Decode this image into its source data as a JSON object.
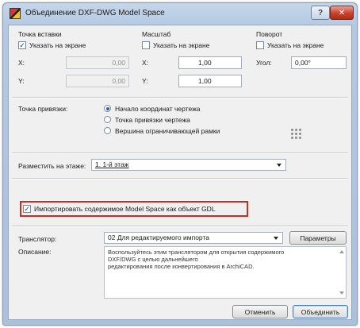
{
  "window": {
    "title": "Объединение DXF-DWG Model Space",
    "help_symbol": "?",
    "close_symbol": "✕"
  },
  "insertion": {
    "heading": "Точка вставки",
    "pick_on_screen": "Указать на экране",
    "pick_checked": true,
    "x_label": "X:",
    "x_value": "0,00",
    "y_label": "Y:",
    "y_value": "0,00"
  },
  "scale": {
    "heading": "Масштаб",
    "pick_on_screen": "Указать на экране",
    "pick_checked": false,
    "x_label": "X:",
    "x_value": "1,00",
    "y_label": "Y:",
    "y_value": "1,00"
  },
  "rotation": {
    "heading": "Поворот",
    "pick_on_screen": "Указать на экране",
    "pick_checked": false,
    "angle_label": "Угол:",
    "angle_value": "0,00°"
  },
  "anchor": {
    "label": "Точка привязки:",
    "options": [
      "Начало координат чертежа",
      "Точка привязки чертежа",
      "Вершина ограничивающей рамки"
    ],
    "selected_index": 0
  },
  "floor": {
    "label": "Разместить на этаже:",
    "value": "1. 1-й этаж"
  },
  "gdl_import": {
    "label": "Импортировать содержимое Model Space как объект GDL",
    "checked": true
  },
  "translator": {
    "label": "Транслятор:",
    "value": "02 Для редактируемого импорта",
    "params_button": "Параметры"
  },
  "description": {
    "label": "Описание:",
    "lines": [
      "Воспользуйтесь этим транслятором для открытия содержимого",
      "DXF/DWG с целью дальнейшего",
      "редактирования после конвертирования в ArchiCAD."
    ]
  },
  "footer": {
    "cancel": "Отменить",
    "merge": "Объединить"
  },
  "colors": {
    "highlight": "#c03228",
    "accent": "#2a5db0"
  }
}
